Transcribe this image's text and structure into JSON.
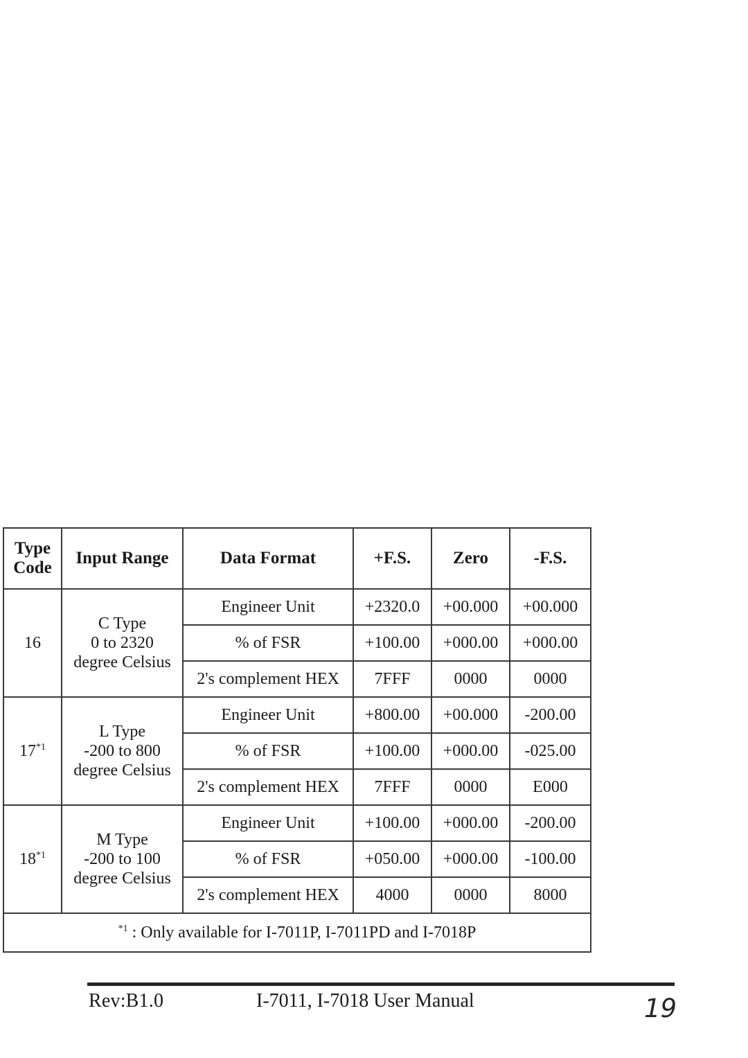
{
  "table": {
    "columns": [
      "Type\nCode",
      "Input Range",
      "Data Format",
      "+F.S.",
      "Zero",
      "-F.S."
    ],
    "headers": {
      "type_code_line1": "Type",
      "type_code_line2": "Code",
      "input_range": "Input Range",
      "data_format": "Data Format",
      "plus_fs": "+F.S.",
      "zero": "Zero",
      "minus_fs": "-F.S."
    },
    "groups": [
      {
        "type_code": "16",
        "type_code_note": "",
        "range_line1": "C Type",
        "range_line2": "0 to 2320",
        "range_line3": "degree Celsius",
        "rows": [
          {
            "format": "Engineer Unit",
            "plus_fs": "+2320.0",
            "zero": "+00.000",
            "minus_fs": "+00.000"
          },
          {
            "format": "% of FSR",
            "plus_fs": "+100.00",
            "zero": "+000.00",
            "minus_fs": "+000.00"
          },
          {
            "format": "2's complement HEX",
            "plus_fs": "7FFF",
            "zero": "0000",
            "minus_fs": "0000"
          }
        ]
      },
      {
        "type_code": "17",
        "type_code_note": "*1",
        "range_line1": "L Type",
        "range_line2": "-200 to 800",
        "range_line3": "degree Celsius",
        "rows": [
          {
            "format": "Engineer Unit",
            "plus_fs": "+800.00",
            "zero": "+00.000",
            "minus_fs": "-200.00"
          },
          {
            "format": "% of FSR",
            "plus_fs": "+100.00",
            "zero": "+000.00",
            "minus_fs": "-025.00"
          },
          {
            "format": "2's complement HEX",
            "plus_fs": "7FFF",
            "zero": "0000",
            "minus_fs": "E000"
          }
        ]
      },
      {
        "type_code": "18",
        "type_code_note": "*1",
        "range_line1": "M Type",
        "range_line2": "-200 to 100",
        "range_line3": "degree Celsius",
        "rows": [
          {
            "format": "Engineer Unit",
            "plus_fs": "+100.00",
            "zero": "+000.00",
            "minus_fs": "-200.00"
          },
          {
            "format": "% of FSR",
            "plus_fs": "+050.00",
            "zero": "+000.00",
            "minus_fs": "-100.00"
          },
          {
            "format": "2's complement HEX",
            "plus_fs": "4000",
            "zero": "0000",
            "minus_fs": "8000"
          }
        ]
      }
    ],
    "footnote": {
      "marker": "*1",
      "text": " : Only available for I-7011P, I-7011PD and I-7018P"
    }
  },
  "footer": {
    "revision": "Rev:B1.0",
    "title": "I-7011, I-7018 User Manual",
    "page_number": "19"
  }
}
